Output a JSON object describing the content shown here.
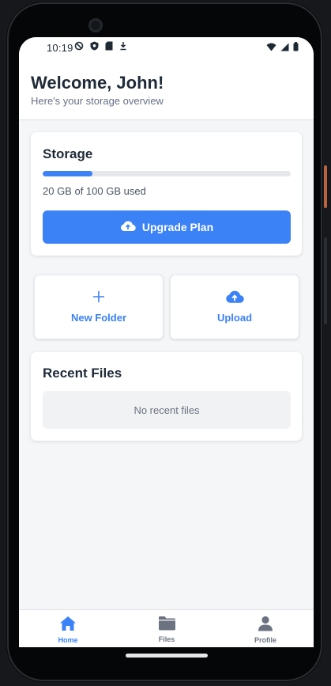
{
  "status_bar": {
    "time": "10:19",
    "left_icons": [
      "shield-slash-icon",
      "shield-icon",
      "sd-card-icon",
      "download-icon"
    ],
    "right_icons": [
      "wifi-icon",
      "cellular-signal-icon",
      "battery-icon"
    ]
  },
  "header": {
    "title": "Welcome, John!",
    "subtitle": "Here's your storage overview"
  },
  "storage": {
    "title": "Storage",
    "used_gb": 20,
    "total_gb": 100,
    "usage_fraction": 0.2,
    "usage_text": "20 GB of 100 GB used",
    "upgrade_label": "Upgrade Plan"
  },
  "actions": [
    {
      "label": "New Folder",
      "icon": "plus-icon"
    },
    {
      "label": "Upload",
      "icon": "cloud-upload-icon"
    }
  ],
  "recent_files": {
    "title": "Recent Files",
    "empty_text": "No recent files"
  },
  "bottom_nav": [
    {
      "label": "Home",
      "icon": "home-icon",
      "active": true
    },
    {
      "label": "Files",
      "icon": "folder-icon",
      "active": false
    },
    {
      "label": "Profile",
      "icon": "profile-icon",
      "active": false
    }
  ],
  "colors": {
    "accent": "#3b82f6",
    "inactive_nav": "#6b7280",
    "title_text": "#1f2a37",
    "screen_background": "#f4f6f8"
  }
}
